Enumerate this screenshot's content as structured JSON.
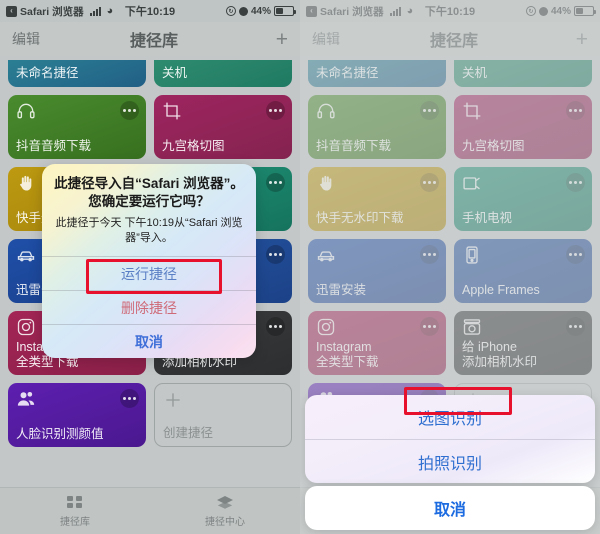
{
  "status_bar": {
    "back_glyph": "‹",
    "app_name": "Safari 浏览器",
    "signal_icon": "signal-bars-icon",
    "wifi_icon": "wifi-icon",
    "time": "下午10:19",
    "orientation_lock_icon": "rotation-lock-icon",
    "alarm_icon": "alarm-icon",
    "battery_percent": "44%",
    "battery_icon": "battery-icon"
  },
  "nav": {
    "edit_label": "编辑",
    "title": "捷径库",
    "add_label": "+"
  },
  "tiles": [
    {
      "label": "未命名捷径",
      "color": "#2b7f93",
      "color2": "#215f86",
      "icon": "",
      "short": true,
      "dots": false
    },
    {
      "label": "关机",
      "color": "#2f8b6e",
      "color2": "#1f7a63",
      "icon": "",
      "short": true,
      "dots": false
    },
    {
      "label": "抖音音频下载",
      "color": "#4a8b2e",
      "color2": "#37701f",
      "icon": "headphones-icon",
      "short": false,
      "dots": true
    },
    {
      "label": "九宫格切图",
      "color": "#9e2560",
      "color2": "#84234f",
      "icon": "crop-icon",
      "short": false,
      "dots": true
    },
    {
      "label": "快手无水印下载",
      "color": "#bd9a11",
      "color2": "#a5840c",
      "icon": "hand-icon",
      "short": false,
      "dots": true
    },
    {
      "label": "手机电视",
      "color": "#1f8f74",
      "color2": "#15735d",
      "icon": "tv-icon",
      "short": false,
      "dots": true
    },
    {
      "label": "迅雷安装",
      "color": "#1f4fa8",
      "color2": "#1a3f8a",
      "icon": "car-icon",
      "short": false,
      "dots": true
    },
    {
      "label": "Apple Frames",
      "color": "#23529f",
      "color2": "#1c4288",
      "icon": "device-icon",
      "short": false,
      "dots": true
    },
    {
      "label": "Instagram\n全类型下载",
      "color": "#a32556",
      "color2": "#8b2049",
      "icon": "instagram-icon",
      "short": false,
      "dots": true
    },
    {
      "label": "给 iPhone\n添加相机水印",
      "color": "#3a3c3e",
      "color2": "#2c2e30",
      "icon": "camera-watermark-icon",
      "short": false,
      "dots": true
    },
    {
      "label": "人脸识别测颜值",
      "color": "#5d1fb0",
      "color2": "#4b188f",
      "icon": "people-icon",
      "short": false,
      "dots": true
    },
    {
      "label": "创建捷径",
      "color": "",
      "color2": "",
      "icon": "plus-icon",
      "short": false,
      "dots": false,
      "create": true
    }
  ],
  "tabbar": {
    "tabs": [
      {
        "label": "捷径库",
        "icon": "grid-icon"
      },
      {
        "label": "捷径中心",
        "icon": "layers-icon"
      }
    ]
  },
  "alert": {
    "title": "此捷径导入自“Safari 浏览器”。您确定要运行它吗？",
    "message": "此捷径于今天 下午10:19从“Safari 浏览器”导入。",
    "buttons": [
      {
        "label": "运行捷径",
        "style": "run",
        "highlighted": true
      },
      {
        "label": "删除捷径",
        "style": "del",
        "highlighted": false
      },
      {
        "label": "取消",
        "style": "cancel",
        "highlighted": false
      }
    ]
  },
  "action_sheet": {
    "options": [
      {
        "label": "选图识别",
        "highlighted": true
      },
      {
        "label": "拍照识别",
        "highlighted": false
      }
    ],
    "cancel_label": "取消"
  },
  "annotation": {
    "color": "#e8112d"
  }
}
